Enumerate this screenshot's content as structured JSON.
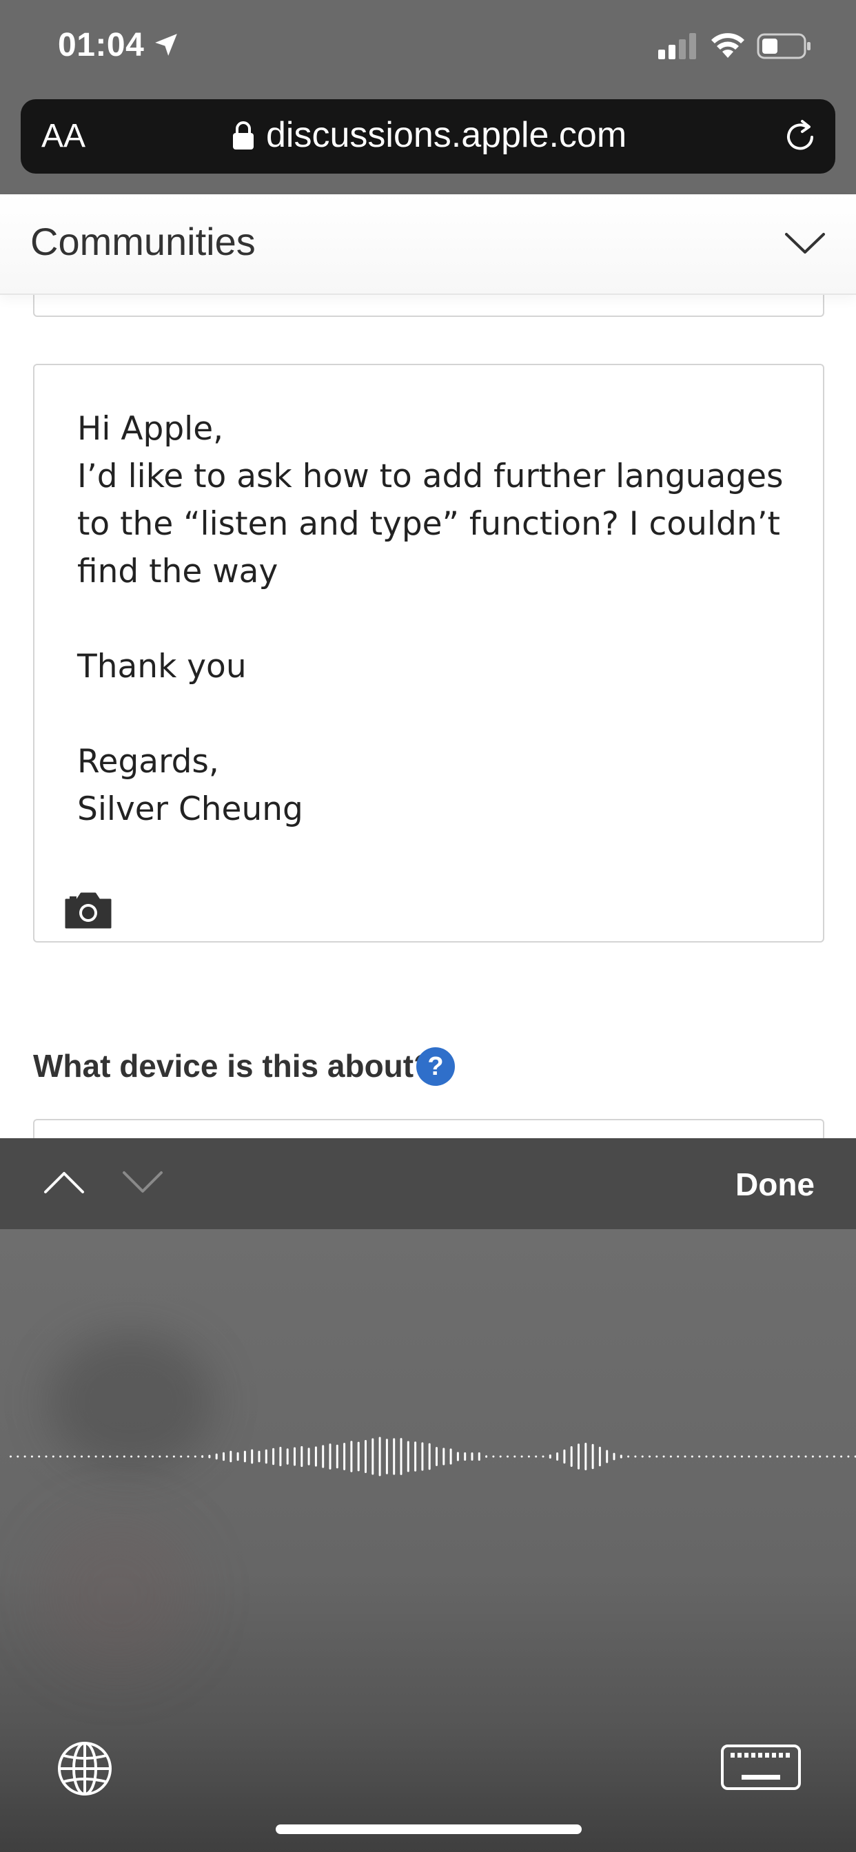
{
  "status_bar": {
    "time": "01:04"
  },
  "browser": {
    "text_size_label": "AA",
    "url": "discussions.apple.com"
  },
  "header": {
    "title": "Communities"
  },
  "message": {
    "body": "Hi Apple,\nI’d like to ask how to add further languages to the “listen and type” function? I couldn’t find the way\n\nThank you\n\nRegards,\nSilver Cheung"
  },
  "device_section": {
    "question": "What device is this about?",
    "help_label": "?"
  },
  "accessory": {
    "done_label": "Done"
  },
  "colors": {
    "help_badge": "#2f6fca",
    "chrome_gray": "#6a6a6a",
    "url_bar": "#151515",
    "accessory_bar": "#4a4a4a"
  },
  "icons": [
    "location-arrow-icon",
    "signal-icon",
    "wifi-icon",
    "battery-icon",
    "lock-icon",
    "reload-icon",
    "chevron-down-icon",
    "camera-icon",
    "chevron-up-icon",
    "globe-icon",
    "keyboard-icon"
  ]
}
